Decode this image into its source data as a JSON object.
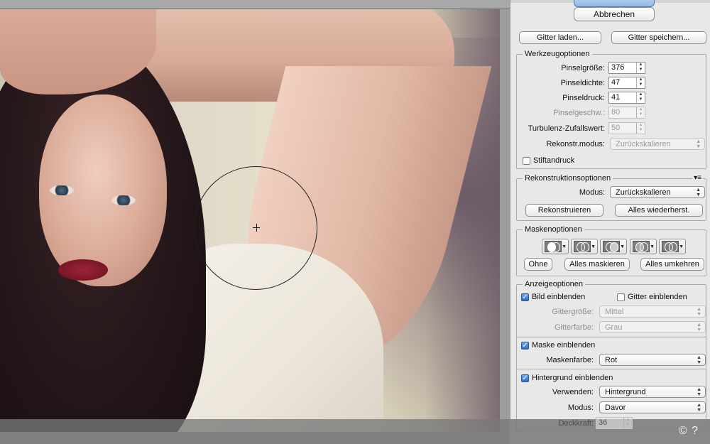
{
  "top_buttons": {
    "cancel": "Abbrechen"
  },
  "grid_buttons": {
    "load": "Gitter laden...",
    "save": "Gitter speichern..."
  },
  "tool_options": {
    "title": "Werkzeugoptionen",
    "brush_size": {
      "label": "Pinselgröße:",
      "value": "376"
    },
    "brush_density": {
      "label": "Pinseldichte:",
      "value": "47"
    },
    "brush_pressure": {
      "label": "Pinseldruck:",
      "value": "41"
    },
    "brush_rate": {
      "label": "Pinselgeschw.:",
      "value": "80"
    },
    "turbulent_jitter": {
      "label": "Turbulenz-Zufallswert:",
      "value": "50"
    },
    "reconstruct_mode": {
      "label": "Rekonstr.modus:",
      "value": "Zurückskalieren"
    },
    "stylus_pressure": {
      "label": "Stiftandruck",
      "checked": false
    }
  },
  "reconstruct_options": {
    "title": "Rekonstruktionsoptionen",
    "menu_icon": "▾≡",
    "mode": {
      "label": "Modus:",
      "value": "Zurückskalieren"
    },
    "reconstruct": "Rekonstruieren",
    "restore_all": "Alles wiederherst."
  },
  "mask_options": {
    "title": "Maskenoptionen",
    "modes": [
      "replace-selection-icon",
      "add-to-selection-icon",
      "subtract-from-selection-icon",
      "intersect-with-selection-icon",
      "invert-selection-icon"
    ],
    "none": "Ohne",
    "mask_all": "Alles maskieren",
    "invert_all": "Alles umkehren"
  },
  "view_options": {
    "title": "Anzeigeoptionen",
    "show_image": {
      "label": "Bild einblenden",
      "checked": true
    },
    "show_mesh": {
      "label": "Gitter einblenden",
      "checked": false
    },
    "mesh_size": {
      "label": "Gittergröße:",
      "value": "Mittel"
    },
    "mesh_color": {
      "label": "Gitterfarbe:",
      "value": "Grau"
    },
    "show_mask": {
      "label": "Maske einblenden",
      "checked": true
    },
    "mask_color": {
      "label": "Maskenfarbe:",
      "value": "Rot"
    },
    "show_backdrop": {
      "label": "Hintergrund einblenden",
      "checked": true
    },
    "use": {
      "label": "Verwenden:",
      "value": "Hintergrund"
    },
    "mode": {
      "label": "Modus:",
      "value": "Davor"
    },
    "opacity": {
      "label": "Deckkraft:",
      "value": "36"
    }
  },
  "status": {
    "text": "© ?"
  },
  "colors": {
    "panel_bg": "#e8e8e8",
    "checkbox_on": "#2f6fc3",
    "canvas_bg": "#9d9d9d"
  }
}
